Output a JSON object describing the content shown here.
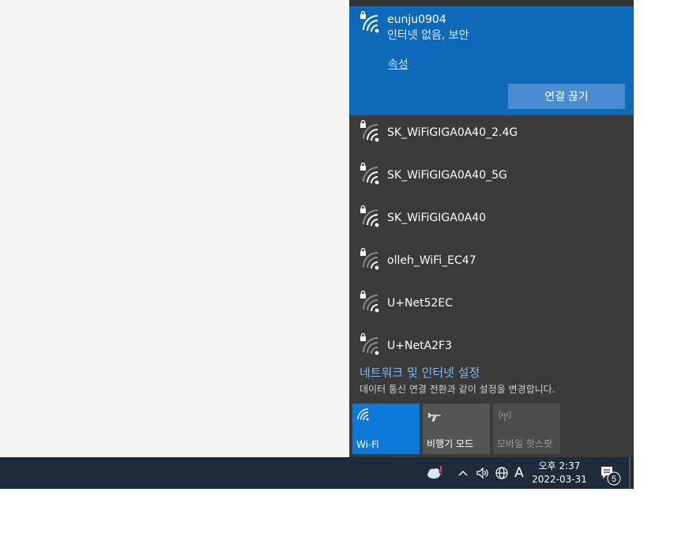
{
  "flyout": {
    "connected": {
      "ssid": "eunju0904",
      "status": "인터넷 없음, 보안",
      "properties_label": "속성",
      "disconnect_label": "연결 끊기"
    },
    "networks": [
      {
        "name": "SK_WiFiGIGA0A40_2.4G"
      },
      {
        "name": "SK_WiFiGIGA0A40_5G"
      },
      {
        "name": "SK_WiFiGIGA0A40"
      },
      {
        "name": "olleh_WiFi_EC47"
      },
      {
        "name": "U+Net52EC"
      },
      {
        "name": "U+NetA2F3"
      }
    ],
    "settings_link": "네트워크 및 인터넷 설정",
    "settings_desc": "데이터 통신 연결 전환과 같이 설정을 변경합니다.",
    "quick_actions": {
      "wifi": "Wi-Fi",
      "airplane": "비행기 모드",
      "hotspot": "모바일 핫스팟"
    }
  },
  "taskbar": {
    "ime": "A",
    "time": "오후 2:37",
    "date": "2022-03-31",
    "notification_count": "5"
  },
  "colors": {
    "accent": "#0e6ab8",
    "flyout_bg": "#3a3a3a",
    "taskbar_bg": "#1f2b3a",
    "link": "#7fb9ee"
  },
  "icons": {
    "secured_wifi": "wifi-lock-icon",
    "airplane": "airplane-icon",
    "hotspot": "hotspot-icon",
    "weather": "weather-alert-icon",
    "chevron": "chevron-up-icon",
    "volume": "volume-icon",
    "network": "globe-network-icon",
    "notifications": "action-center-icon"
  }
}
